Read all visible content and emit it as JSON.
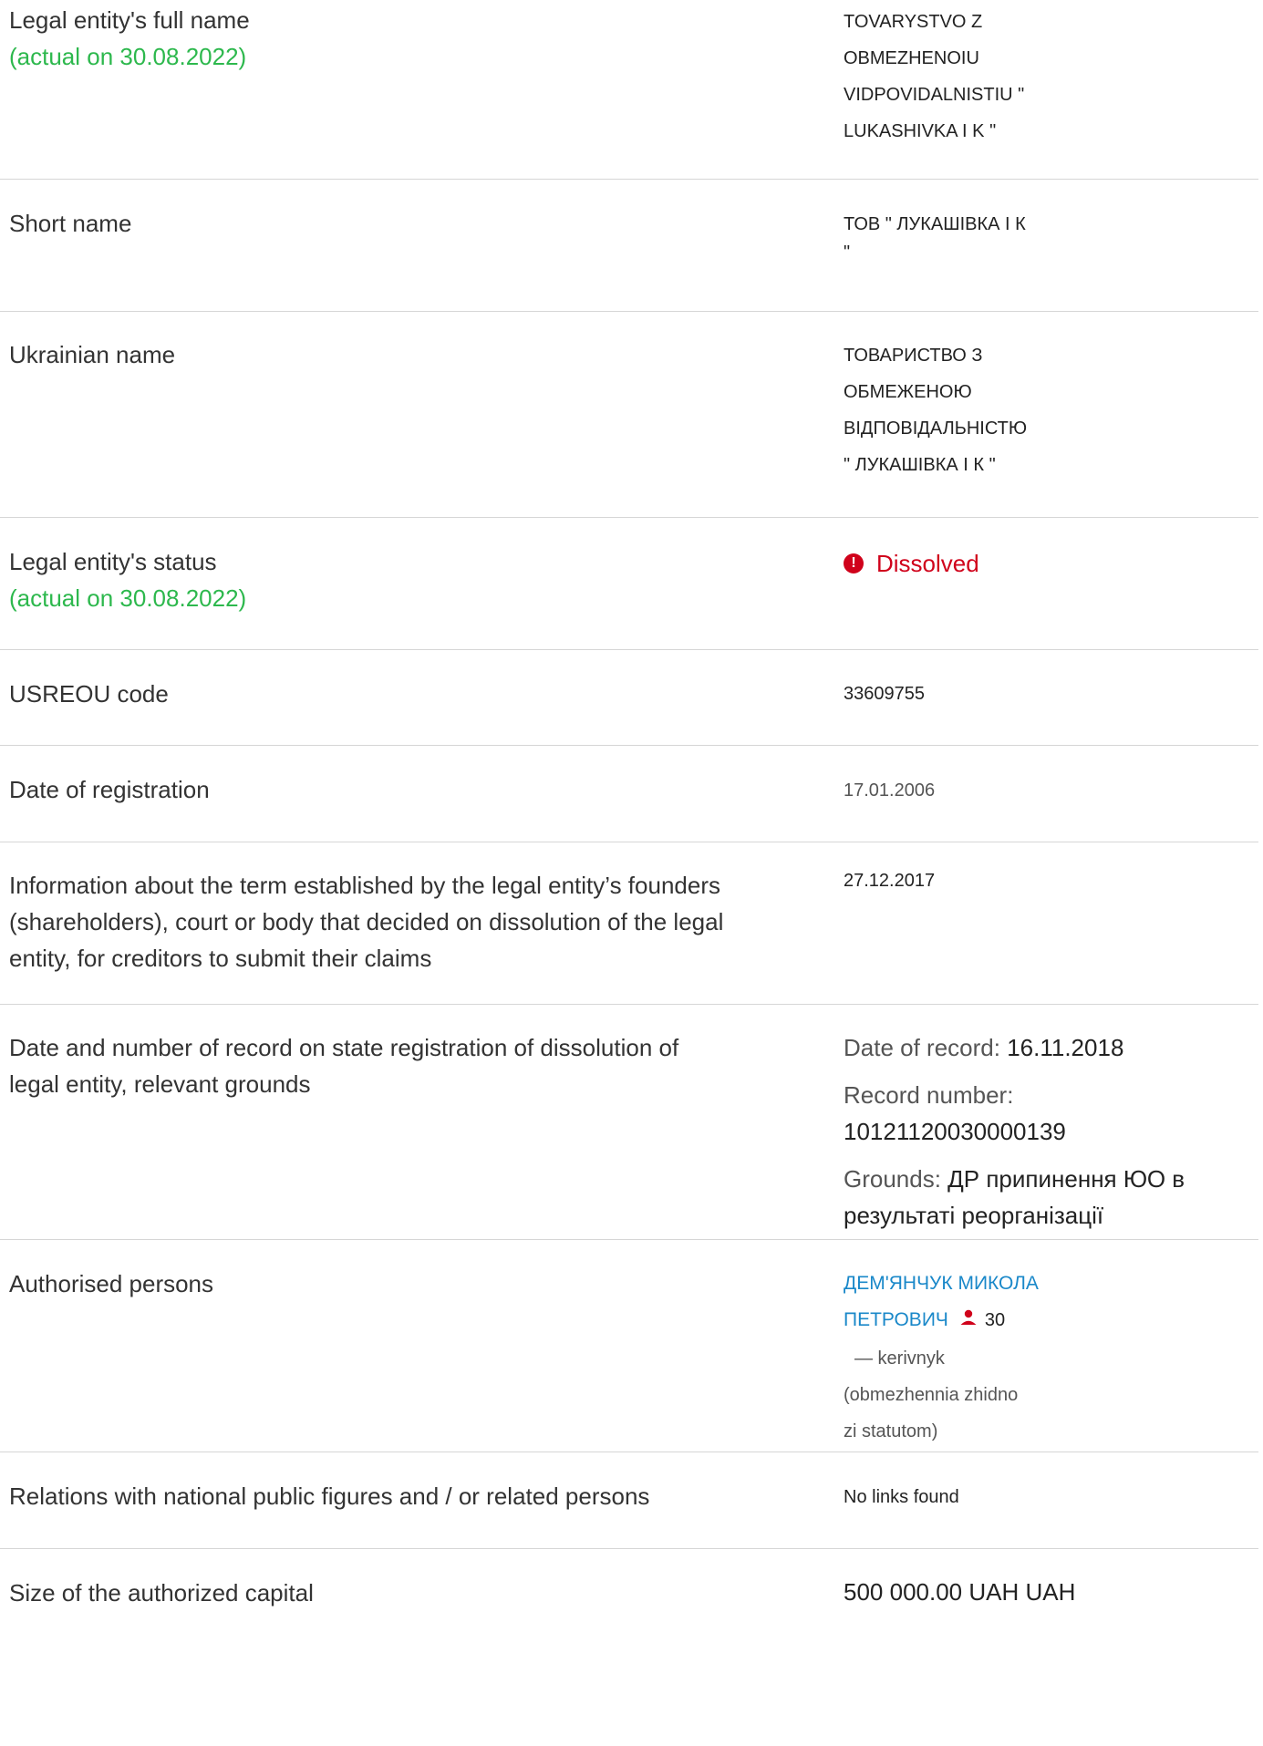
{
  "rows": {
    "full_name": {
      "label": "Legal entity's full name",
      "actual": "(actual on 30.08.2022)",
      "lines": [
        "TOVARYSTVO Z",
        "OBMEZHENOIU",
        "VIDPOVIDALNISTIU \"",
        "LUKASHIVKA I K \""
      ]
    },
    "short_name": {
      "label": "Short name",
      "lines": [
        "ТОВ \" ЛУКАШІВКА І К",
        "\""
      ]
    },
    "ukrainian_name": {
      "label": "Ukrainian name",
      "lines": [
        "ТОВАРИСТВО З",
        "ОБМЕЖЕНОЮ",
        "ВІДПОВІДАЛЬНІСТЮ",
        "\" ЛУКАШІВКА І К \""
      ]
    },
    "status": {
      "label": "Legal entity's status",
      "actual": "(actual on 30.08.2022)",
      "icon": "alert-circle-icon",
      "icon_glyph": "!",
      "value": "Dissolved",
      "color": "#d0021b"
    },
    "usreou": {
      "label": "USREOU code",
      "value": "33609755"
    },
    "registration": {
      "label": "Date of registration",
      "value": "17.01.2006"
    },
    "creditors_term": {
      "label_lines": [
        "Information about the term established by the legal entity’s founders",
        "(shareholders), court or body that decided on dissolution of the legal",
        "entity, for creditors to submit their claims"
      ],
      "value": "27.12.2017"
    },
    "dissolution_record": {
      "label_lines": [
        "Date and number of record on state registration of dissolution of",
        "legal entity, relevant grounds"
      ],
      "date_label": "Date of record: ",
      "date_value": "16.11.2018",
      "number_label": "Record number:",
      "number_value": "10121120030000139",
      "grounds_label": "Grounds: ",
      "grounds_value_1": "ДР припинення ЮО в",
      "grounds_value_2": "результаті реорганізації"
    },
    "authorised": {
      "label": "Authorised persons",
      "name_line_1": "ДЕМ'ЯНЧУК МИКОЛА",
      "name_line_2": "ПЕТРОВИЧ",
      "person_icon": "person-icon",
      "count": "30",
      "role_lines": [
        "— kerivnyk",
        "(obmezhennia zhidno",
        "zi statutom)"
      ]
    },
    "relations": {
      "label": "Relations with national public figures and / or related persons",
      "value": "No links found"
    },
    "capital": {
      "label": "Size of the authorized capital",
      "value": "500 000.00 UAH UAH"
    }
  },
  "colors": {
    "accent_green": "#2db84d",
    "link_blue": "#1a88c9",
    "alert_red": "#d0021b"
  }
}
